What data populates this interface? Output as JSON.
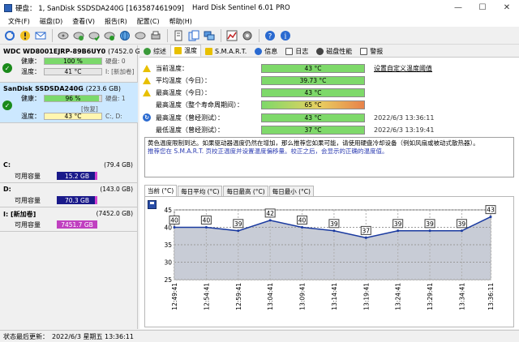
{
  "window": {
    "title_left": "硬盘：  1, SanDisk SSDSDA240G [163587461909]",
    "title_center": "Hard Disk Sentinel 6.01 PRO",
    "minimize": "—",
    "maximize": "☐",
    "close": "✕"
  },
  "menu": [
    "文件(F)",
    "磁盘(D)",
    "查看(V)",
    "报告(R)",
    "配置(C)",
    "帮助(H)"
  ],
  "toolbar": [
    "refresh-icon",
    "alert-icon",
    "mail-icon",
    "disk-icon",
    "disk-check-icon",
    "disk-ok-icon",
    "disk-go-icon",
    "disk-globe-icon",
    "disk-test-icon",
    "disk-print-icon",
    "report-icon",
    "copy-icon",
    "network-icon",
    "chart-icon",
    "settings-icon",
    "help-icon",
    "info-icon"
  ],
  "disks": [
    {
      "name": "WDC WD8001EJRP-89B6UY0",
      "size": "(7452.0 GB)",
      "health_label": "健康：",
      "health": "100 %",
      "health_pct": 100,
      "temp_label": "温度：",
      "temp": "41 °C",
      "side1": "硬盘: 0",
      "side2": "I: [新加卷]"
    },
    {
      "name": "SanDisk SSDSDA240G",
      "size": "(223.6 GB)",
      "health_label": "健康：",
      "health": "96 %",
      "health_pct": 96,
      "temp_label": "温度：",
      "temp": "43 °C",
      "side1": "硬盘: 1",
      "side2": "[恢复]",
      "side3": "C:, D:"
    }
  ],
  "volumes": [
    {
      "name": "C:",
      "size": "(79.4 GB)",
      "free_label": "可用容量",
      "free": "15.2 GB",
      "bar_color": "#1a1a8a"
    },
    {
      "name": "D:",
      "size": "(143.0 GB)",
      "free_label": "可用容量",
      "free": "70.3 GB",
      "bar_color": "#1a1a8a"
    },
    {
      "name": "I: [新加卷]",
      "size": "(7452.0 GB)",
      "free_label": "可用容量",
      "free": "7451.7 GB",
      "bar_color": "#c040c0"
    }
  ],
  "tabs": [
    "综述",
    "温度",
    "S.M.A.R.T.",
    "信息",
    "日志",
    "磁盘性能",
    "警报"
  ],
  "temperatures": [
    {
      "icon": "warn",
      "label": "当前温度：",
      "value": "43 °C",
      "color": "#7ed96a",
      "pct": 100,
      "right": ""
    },
    {
      "icon": "warn",
      "label": "平均温度（今日）：",
      "value": "39.73 °C",
      "color": "#7ed96a",
      "pct": 100,
      "right": ""
    },
    {
      "icon": "warn",
      "label": "最高温度（今日）：",
      "value": "43 °C",
      "color": "#7ed96a",
      "pct": 100,
      "right": ""
    },
    {
      "icon": "none",
      "label": "最高温度（整个寿命周期间）：",
      "value": "65 °C",
      "color": "#e8824a",
      "pct": 100,
      "right": ""
    },
    {
      "icon": "blue",
      "label": "最高温度（曾经测试）：",
      "value": "43 °C",
      "color": "#7ed96a",
      "pct": 100,
      "right": "2022/6/3 13:36:11"
    },
    {
      "icon": "none",
      "label": "最低温度（曾经测试）：",
      "value": "37 °C",
      "color": "#7ed96a",
      "pct": 100,
      "right": "2022/6/3 13:19:41"
    }
  ],
  "custom_threshold_link": "设置自定义温度阈值",
  "message": {
    "p1": "黄色温度限制到达。如果驱动器温度仍然在增加，那么推荐您如果可能，请使用硬盘冷却设备（例如风扇或被动式散热器）。",
    "p2": "推荐您在 S.M.A.R.T. 页校正温度并设置温度偏移量。校正之后，会显示的正确的温度值。"
  },
  "chart_tabs": [
    "当前 (°C)",
    "每日平均 (°C)",
    "每日最高 (°C)",
    "每日最小 (°C)"
  ],
  "chart_data": {
    "type": "line",
    "x": [
      "12:49:41",
      "12:54:41",
      "12:59:41",
      "13:04:41",
      "13:09:41",
      "13:14:41",
      "13:19:41",
      "13:24:41",
      "13:29:41",
      "13:34:41",
      "13:36:11"
    ],
    "values": [
      40,
      40,
      39,
      42,
      40,
      39,
      37,
      39,
      39,
      39,
      43
    ],
    "ylim": [
      25,
      45
    ],
    "yticks": [
      25,
      30,
      35,
      40,
      45
    ],
    "ylabel": "",
    "xlabel": "",
    "grid": true
  },
  "status": {
    "label": "状态最后更新：",
    "value": "2022/6/3 星期五 13:36:11"
  }
}
